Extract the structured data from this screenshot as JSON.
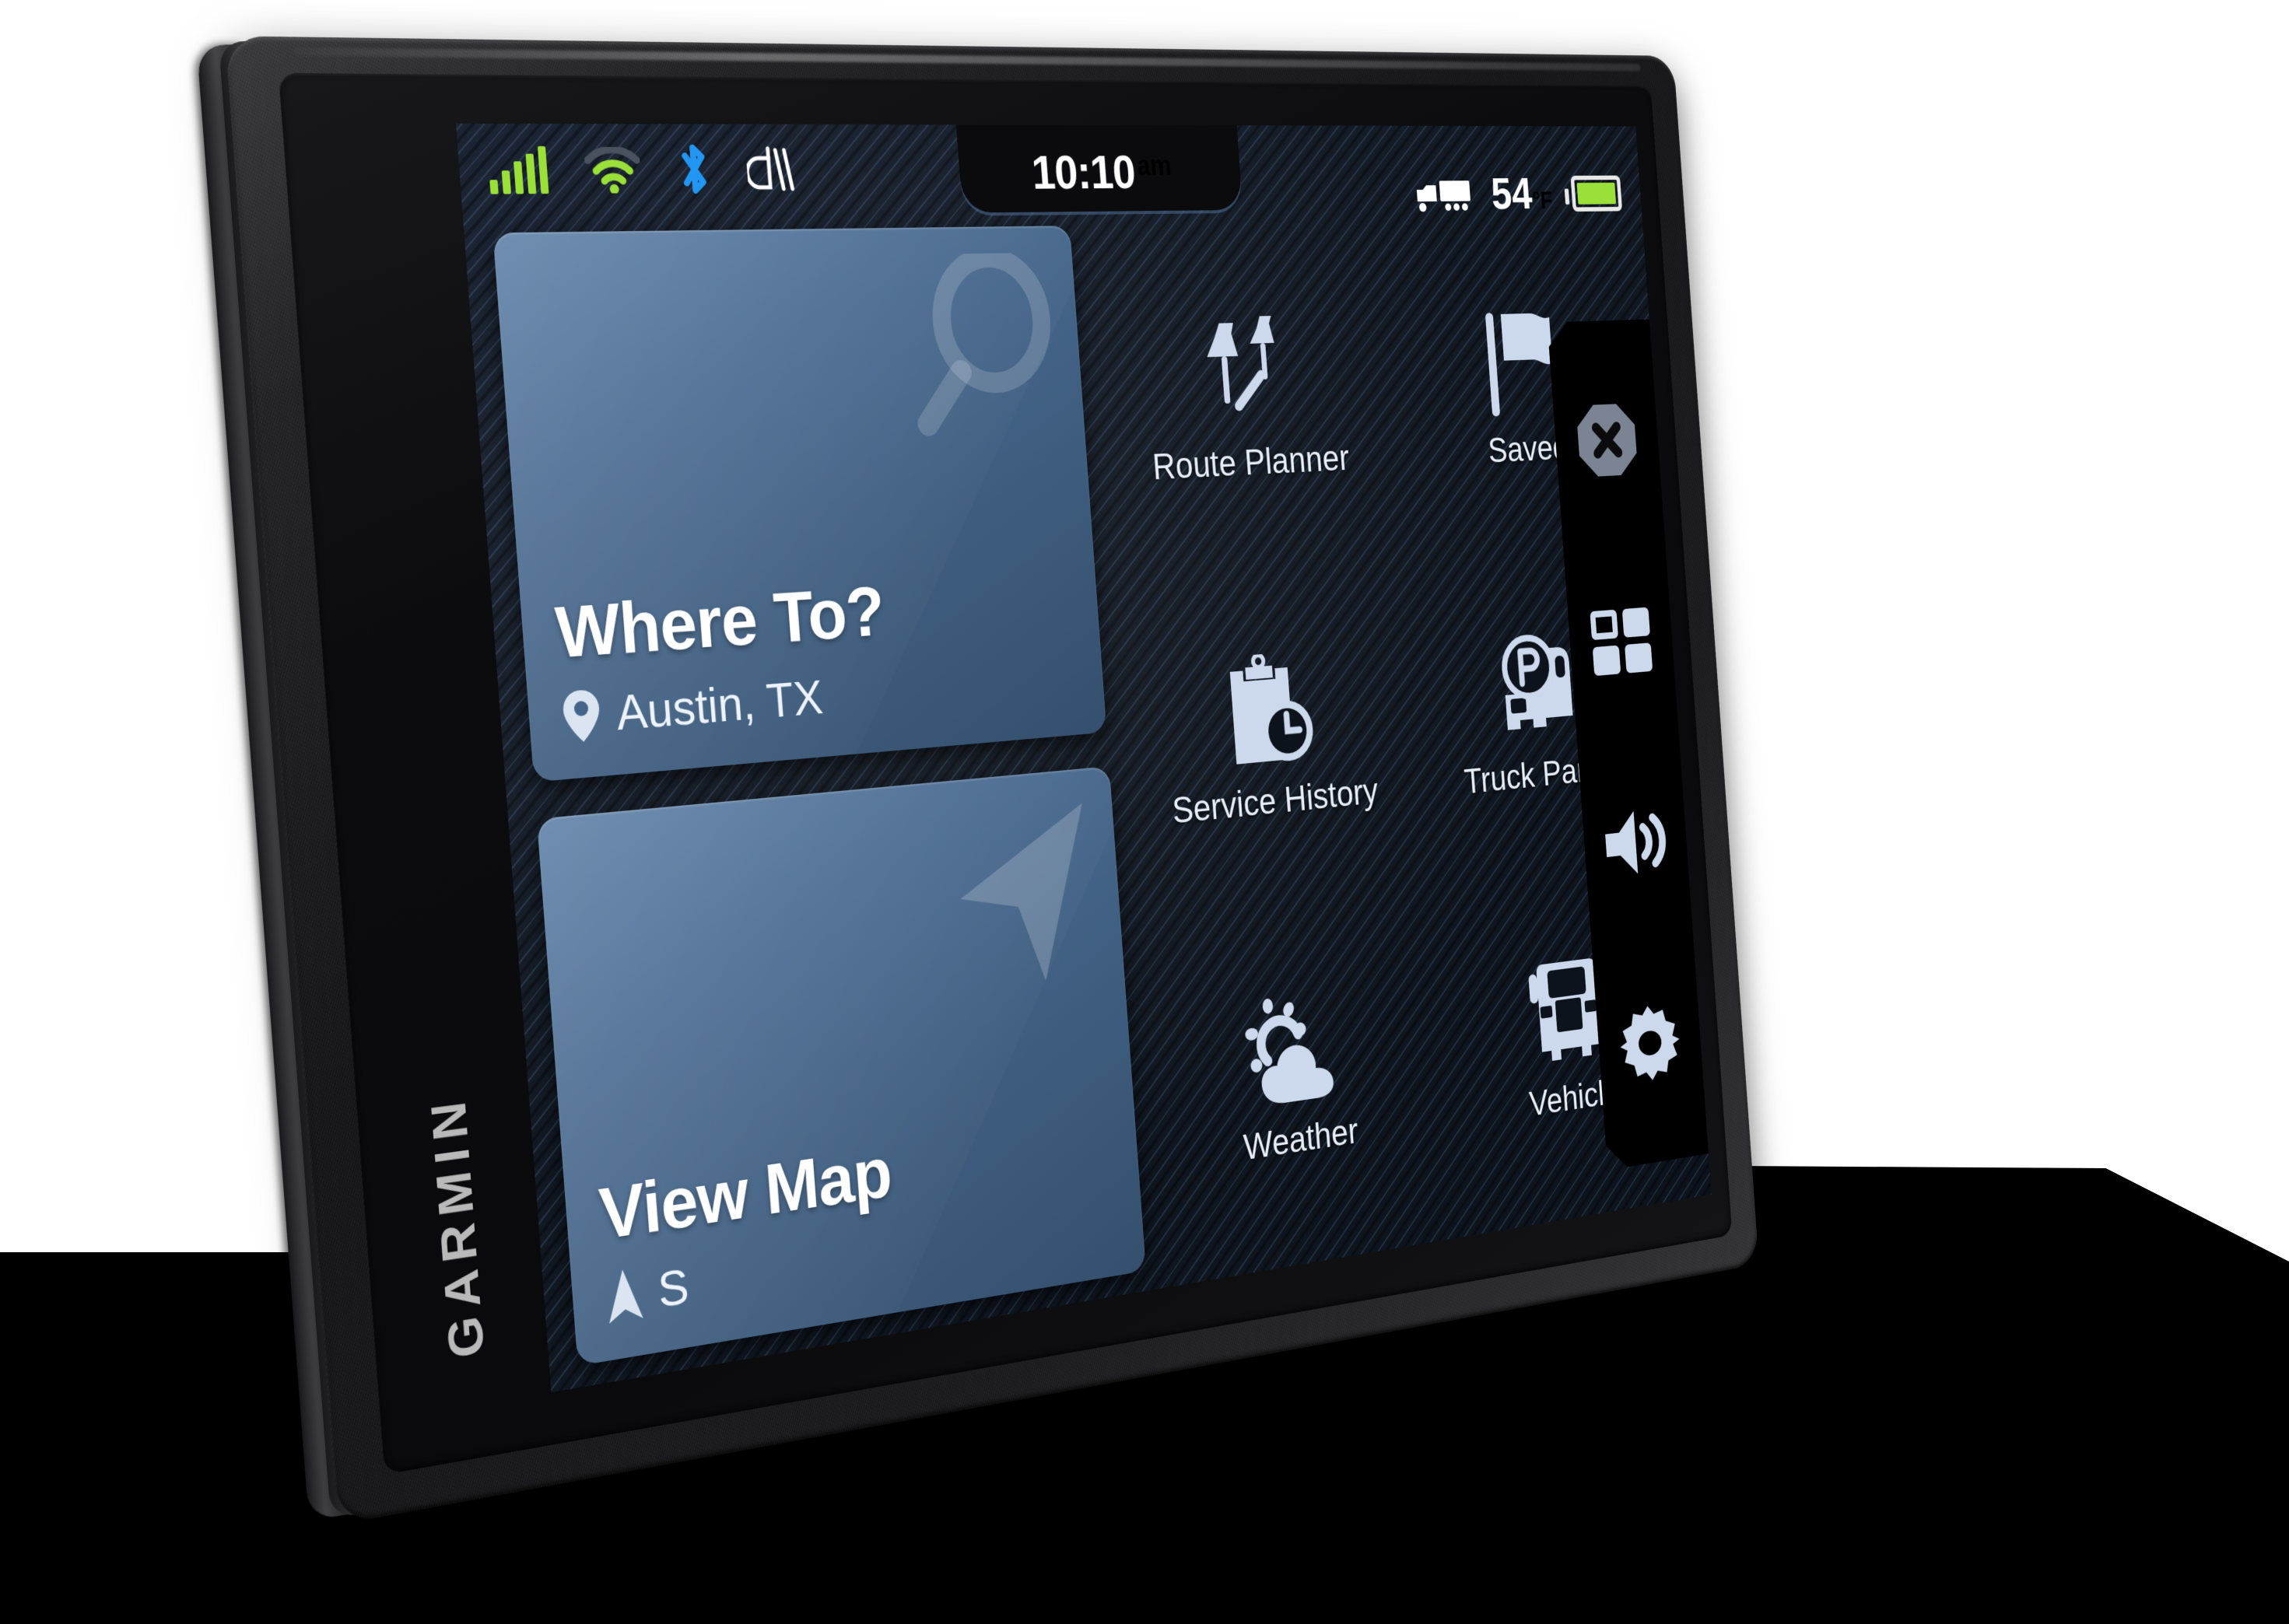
{
  "device": {
    "brand": "GARMIN",
    "accent_blue": "#4b6c92",
    "icon_blue": "#ccd9ec",
    "signal_green": "#9ae038",
    "bluetooth_blue": "#2196f3"
  },
  "statusbar": {
    "icons": [
      {
        "name": "cellular-signal-icon",
        "label": "cellular signal",
        "color": "#9ae038"
      },
      {
        "name": "wifi-icon",
        "label": "wifi",
        "color": "#9ae038"
      },
      {
        "name": "bluetooth-icon",
        "label": "bluetooth",
        "color": "#2196f3"
      },
      {
        "name": "dezl-logo-icon",
        "label": "dezl",
        "color": "#ffffff"
      }
    ],
    "time": "10:10",
    "time_ampm": "am",
    "truck_icon": "truck-profile-icon",
    "temperature": "54",
    "temperature_unit": "°F",
    "battery": {
      "name": "battery-icon",
      "level": "full",
      "color": "#9ae038"
    }
  },
  "cards": [
    {
      "id": "where-to",
      "title": "Where To?",
      "sub_icon": "map-pin-icon",
      "sub_text": "Austin, TX",
      "deco_icon": "magnifier-icon"
    },
    {
      "id": "view-map",
      "title": "View Map",
      "sub_icon": "navigation-arrow-icon",
      "sub_text": "S",
      "deco_icon": "map-cursor-arrow-icon"
    }
  ],
  "apps": [
    {
      "id": "route-planner",
      "label": "Route Planner",
      "icon": "two-pins-route-icon"
    },
    {
      "id": "saved",
      "label": "Saved",
      "icon": "flag-icon"
    },
    {
      "id": "service-history",
      "label": "Service History",
      "icon": "clipboard-clock-icon"
    },
    {
      "id": "truck-parking",
      "label": "Truck Parking",
      "icon": "parking-truck-icon"
    },
    {
      "id": "weather",
      "label": "Weather",
      "icon": "sun-cloud-icon"
    },
    {
      "id": "vehicle",
      "label": "Vehicle",
      "icon": "truck-front-icon"
    }
  ],
  "sidebar": [
    {
      "id": "close",
      "name": "close-button",
      "icon": "x-octagon-icon"
    },
    {
      "id": "apps",
      "name": "apps-button",
      "icon": "grid-apps-icon"
    },
    {
      "id": "volume",
      "name": "volume-button",
      "icon": "speaker-volume-icon"
    },
    {
      "id": "settings",
      "name": "settings-button",
      "icon": "gear-icon"
    }
  ]
}
